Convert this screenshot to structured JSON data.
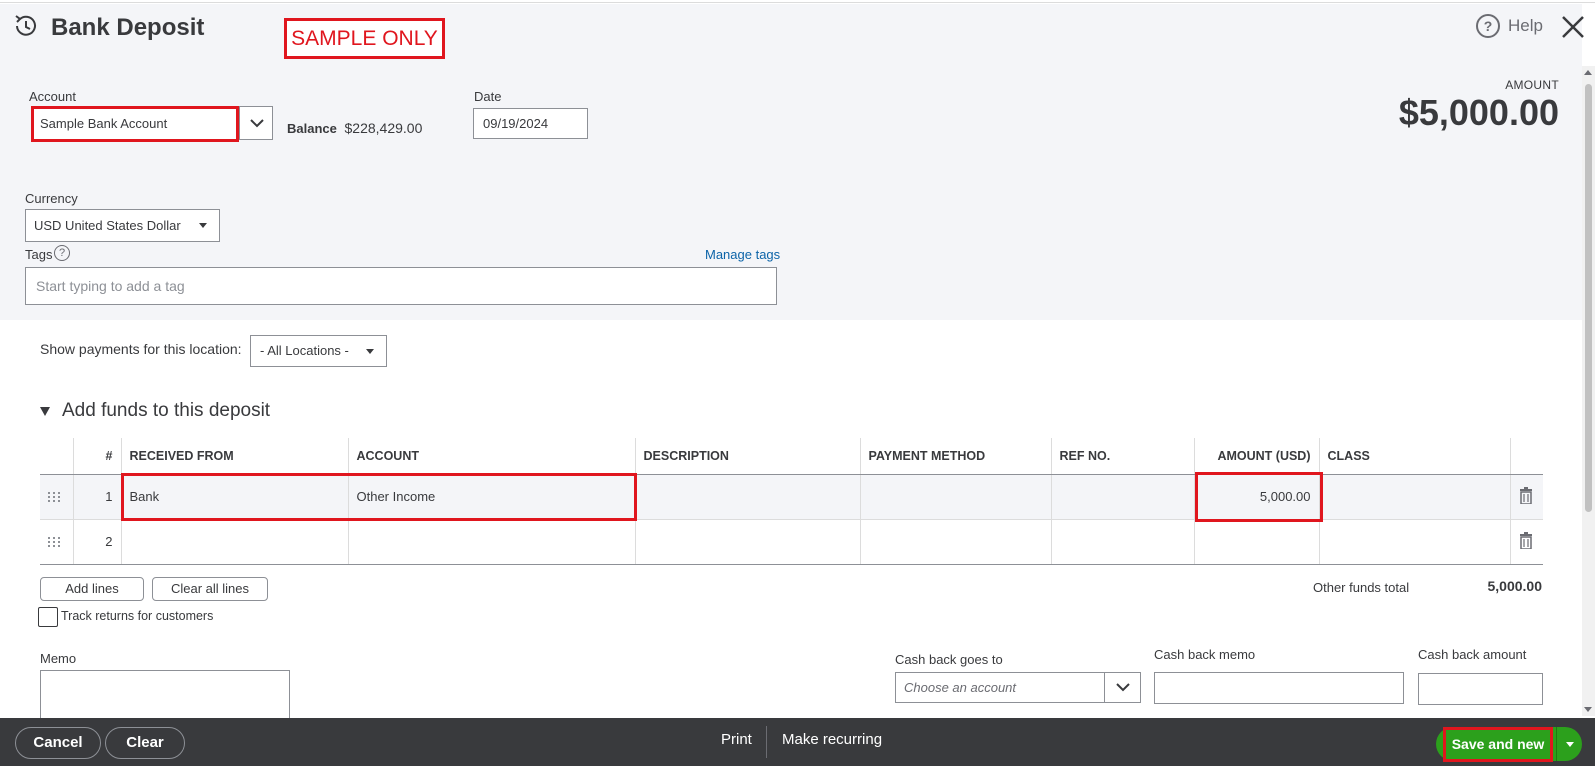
{
  "header": {
    "title": "Bank Deposit",
    "sample_label": "SAMPLE ONLY",
    "help_label": "Help",
    "help_icon_glyph": "?"
  },
  "form": {
    "account_label": "Account",
    "account_value": "Sample Bank Account",
    "balance_label": "Balance",
    "balance_value": "$228,429.00",
    "date_label": "Date",
    "date_value": "09/19/2024",
    "amount_label": "AMOUNT",
    "amount_value": "$5,000.00",
    "currency_label": "Currency",
    "currency_value": "USD United States Dollar",
    "tags_label": "Tags",
    "tags_help_glyph": "?",
    "manage_tags": "Manage tags",
    "tags_placeholder": "Start typing to add a tag",
    "location_label": "Show payments for this location:",
    "location_value": "- All Locations -"
  },
  "funds": {
    "section_title": "Add funds to this deposit",
    "columns": [
      "#",
      "RECEIVED FROM",
      "ACCOUNT",
      "DESCRIPTION",
      "PAYMENT METHOD",
      "REF NO.",
      "AMOUNT (USD)",
      "CLASS"
    ],
    "rows": [
      {
        "num": "1",
        "received_from": "Bank",
        "account": "Other Income",
        "description": "",
        "payment_method": "",
        "ref_no": "",
        "amount": "5,000.00",
        "class": ""
      },
      {
        "num": "2",
        "received_from": "",
        "account": "",
        "description": "",
        "payment_method": "",
        "ref_no": "",
        "amount": "",
        "class": ""
      }
    ],
    "add_lines": "Add lines",
    "clear_all_lines": "Clear all lines",
    "total_label": "Other funds total",
    "total_value": "5,000.00",
    "track_returns": "Track returns for customers"
  },
  "bottom": {
    "memo_label": "Memo",
    "cash_back_to_label": "Cash back goes to",
    "cash_back_to_placeholder": "Choose an account",
    "cash_back_memo_label": "Cash back memo",
    "cash_back_amount_label": "Cash back amount"
  },
  "footer": {
    "cancel": "Cancel",
    "clear": "Clear",
    "print": "Print",
    "make_recurring": "Make recurring",
    "save_and_new": "Save and new"
  },
  "colors": {
    "primary_green": "#2ca01c",
    "annotation_red": "#e0161e",
    "footer_bg": "#393a3d",
    "link_blue": "#0d64a8"
  }
}
